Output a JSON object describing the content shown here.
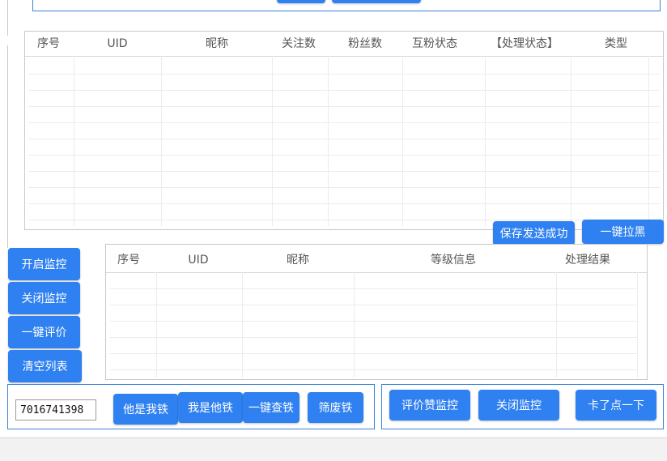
{
  "top_toolbar": {
    "button_1": "",
    "button_2": ""
  },
  "fans_table": {
    "columns": [
      "序号",
      "UID",
      "昵称",
      "关注数",
      "粉丝数",
      "互粉状态",
      "【处理状态】",
      "类型"
    ],
    "rows": []
  },
  "fans_actions": {
    "save_sent_success": "保存发送成功",
    "one_click_block": "一键拉黑"
  },
  "comment_table": {
    "columns": [
      "序号",
      "UID",
      "昵称",
      "等级信息",
      "处理结果"
    ],
    "rows": []
  },
  "side_buttons": {
    "start_monitor": "开启监控",
    "stop_monitor": "关闭监控",
    "one_click_review": "一键评价",
    "clear_list": "清空列表"
  },
  "bottom_left": {
    "uid_input_value": "7016741398",
    "he_is_my_fan": "他是我铁",
    "i_am_his_fan": "我是他铁",
    "one_click_check": "一键查铁",
    "filter_fans": "筛废铁"
  },
  "bottom_right": {
    "like_monitor": "评价赞监控",
    "stop_monitor": "关闭监控",
    "stuck_click": "卡了点一下"
  }
}
